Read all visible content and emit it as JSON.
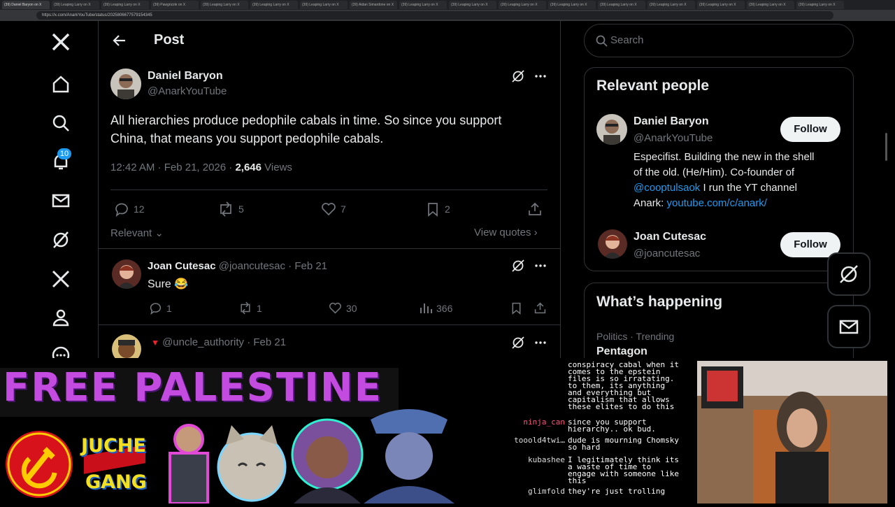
{
  "browser": {
    "tabs": [
      "(39) Daniel Baryon on X",
      "(39) Leaping Larry on X",
      "(39) Leaping Larry on X",
      "(39) Pawgrizzle on X",
      "(39) Leaping Larry on X",
      "(39) Leaping Larry on X",
      "(39) Leaping Larry on X",
      "(39) Aidan Simardone on X",
      "(39) Leaping Larry on X",
      "(39) Leaping Larry on X",
      "(39) Leaping Larry on X",
      "(39) Leaping Larry on X",
      "(39) Leaping Larry on X",
      "(39) Leaping Larry on X",
      "(39) Leaping Larry on X",
      "(39) Leaping Larry on X",
      "(39) Leaping Larry on X"
    ],
    "url": "https://x.com/AnarkYouTube/status/2025806677579154345"
  },
  "nav": {
    "notification_count": "10"
  },
  "header": {
    "title": "Post"
  },
  "post": {
    "author_name": "Daniel Baryon",
    "author_handle": "@AnarkYouTube",
    "text_line1": "All hierarchies produce pedophile cabals in time. So since you support",
    "text_line2": "China, that means you support pedophile cabals.",
    "timestamp": "12:42 AM · Feb 21, 2026 · ",
    "views_count": "2,646",
    "views_label": " Views",
    "replies": "12",
    "reposts": "5",
    "likes": "7",
    "bookmarks": "2",
    "sort_label": "Relevant",
    "view_quotes": "View quotes"
  },
  "replies": [
    {
      "name": "Joan Cutesac",
      "handle": "@joancutesac · Feb 21",
      "text": "Sure 😂",
      "replies": "1",
      "reposts": "1",
      "likes": "30",
      "views": "366"
    },
    {
      "name": "",
      "handle": "@uncle_authority · Feb 21"
    }
  ],
  "sidebar": {
    "search_placeholder": "Search",
    "relevant_title": "Relevant people",
    "people": [
      {
        "name": "Daniel Baryon",
        "handle": "@AnarkYouTube",
        "follow": "Follow",
        "bio1": "Especifist. Building the new in the shell",
        "bio2": "of the old. (He/Him). Co-founder of",
        "bio3_link": "@cooptulsaok",
        "bio3_rest": " I run the YT channel",
        "bio4_text": "Anark: ",
        "bio4_link": "youtube.com/c/anark/"
      },
      {
        "name": "Joan Cutesac",
        "handle": "@joancutesac",
        "follow": "Follow"
      }
    ],
    "happening_title": "What’s happening",
    "trend_category": "Politics · Trending",
    "trend_name": "Pentagon"
  },
  "stream": {
    "banner": "FREE PALESTINE",
    "juche1": "JUCHE",
    "juche2": "GANG",
    "chat": [
      {
        "user": "",
        "msg": "conspiracy cabal when it\ncomes to the epstein\nfiles is so irratating.\nto them, its anything\nand everything but\ncapitalism that allows\nthese elites to do this"
      },
      {
        "user": "ninja_can",
        "msg": "since you support\nhierarchy.. ok bud."
      },
      {
        "user": "tooold4twi…",
        "msg": "dude is mourning Chomsky\nso hard"
      },
      {
        "user": "kubashee",
        "msg": "I legitimately think its\na waste of time to\nengage with someone like\nthis"
      },
      {
        "user": "glimfold",
        "msg": "they're just trolling"
      }
    ]
  },
  "colors": {
    "accent": "#1d9bf0",
    "banner": "#c44bdf",
    "chat_name": "#ff4f7a"
  }
}
